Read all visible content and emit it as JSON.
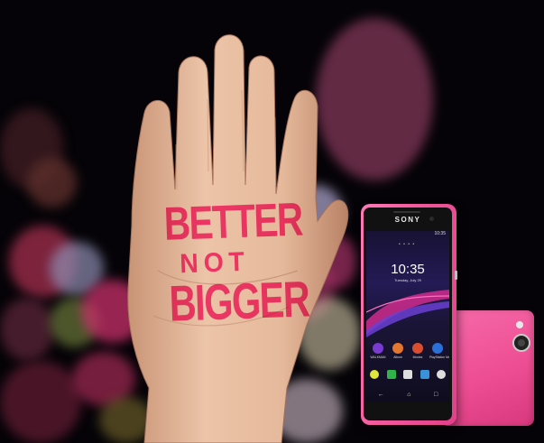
{
  "tagline": {
    "line1": "BETTER",
    "line2": "NOT",
    "line3": "BIGGER",
    "color": "#ff2d8a"
  },
  "phone": {
    "brand": "SONY",
    "color": "#f35a9e",
    "status_time": "10:35",
    "clock": "10:35",
    "date": "Tuesday, July 29",
    "apps": [
      {
        "label": "WALKMAN",
        "color": "#7a3bd0"
      },
      {
        "label": "Album",
        "color": "#e5762d"
      },
      {
        "label": "Movies",
        "color": "#d94e2f"
      },
      {
        "label": "PlayStation Mobile",
        "color": "#2b6fd8"
      }
    ],
    "dock": [
      {
        "name": "chrome-icon",
        "color": "#dfe63c"
      },
      {
        "name": "play-store-icon",
        "color": "#2fb34a"
      },
      {
        "name": "apps-grid-icon",
        "color": "#dddddd"
      },
      {
        "name": "messaging-icon",
        "color": "#3a92d8"
      },
      {
        "name": "phone-app-icon",
        "color": "#dddddd"
      }
    ],
    "nav": [
      "←",
      "⌂",
      "□"
    ]
  },
  "colors": {
    "background": "#050307",
    "skin": "#e9bda0",
    "phone_pink": "#f35a9e"
  }
}
